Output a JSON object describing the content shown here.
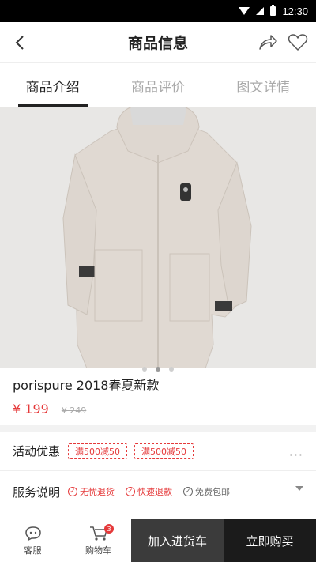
{
  "status_bar": {
    "time": "12:30"
  },
  "header": {
    "title": "商品信息"
  },
  "tabs": [
    {
      "label": "商品介绍",
      "active": true
    },
    {
      "label": "商品评价",
      "active": false
    },
    {
      "label": "图文详情",
      "active": false
    }
  ],
  "carousel": {
    "page_count": 3,
    "active_index": 1
  },
  "product": {
    "name": "porispure 2018春夏新款",
    "price": "¥ 199",
    "original_price": "¥ 249"
  },
  "promotion": {
    "label": "活动优惠",
    "coupons": [
      "满500减50",
      "满500减50"
    ],
    "more": "···"
  },
  "service": {
    "label": "服务说明",
    "items": [
      {
        "text": "无忧退货",
        "color": "#e5393a"
      },
      {
        "text": "快速退款",
        "color": "#e5393a"
      },
      {
        "text": "免费包邮",
        "color": "#666666"
      }
    ]
  },
  "bottom_bar": {
    "service_label": "客服",
    "cart_label": "购物车",
    "cart_badge": "3",
    "add_label": "加入进货车",
    "buy_label": "立即购买"
  },
  "colors": {
    "accent": "#e5393a",
    "dark_button": "#1b1b1b",
    "mid_button": "#3b3b3b"
  }
}
